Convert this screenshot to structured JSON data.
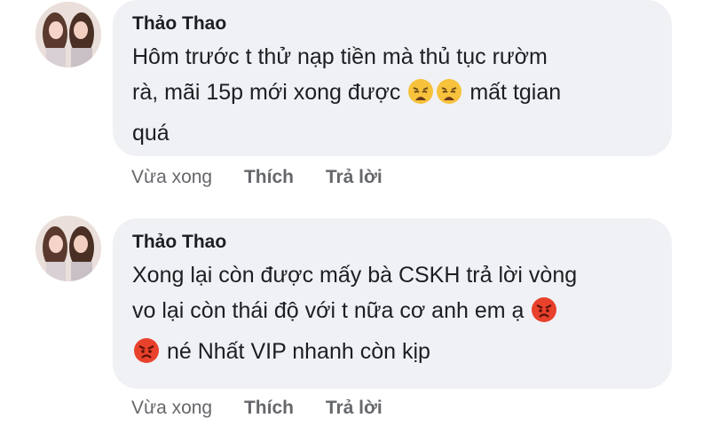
{
  "comments": [
    {
      "author": "Thảo Thao",
      "line1": "Hôm trước t thử nạp tiền mà thủ tục rườm",
      "line2_pre": "rà, mãi 15p mới xong được ",
      "line2_post": " mất tgian",
      "line3": "quá",
      "emoji_name": "weary-face-emoji",
      "time": "Vừa xong",
      "like_label": "Thích",
      "reply_label": "Trả lời"
    },
    {
      "author": "Thảo Thao",
      "line1": "Xong lại còn được mấy bà CSKH trả lời vòng",
      "line2": "vo lại còn thái độ với t nữa cơ anh em ạ ",
      "line3": " né Nhất VIP nhanh còn kịp",
      "emoji_name": "angry-face-emoji",
      "time": "Vừa xong",
      "like_label": "Thích",
      "reply_label": "Trả lời"
    }
  ],
  "colors": {
    "bubble": "#f0f1f5",
    "text": "#1c1e21",
    "meta": "#65676b",
    "weary_emoji": "#f7c23c",
    "angry_emoji": "#e8412c"
  }
}
